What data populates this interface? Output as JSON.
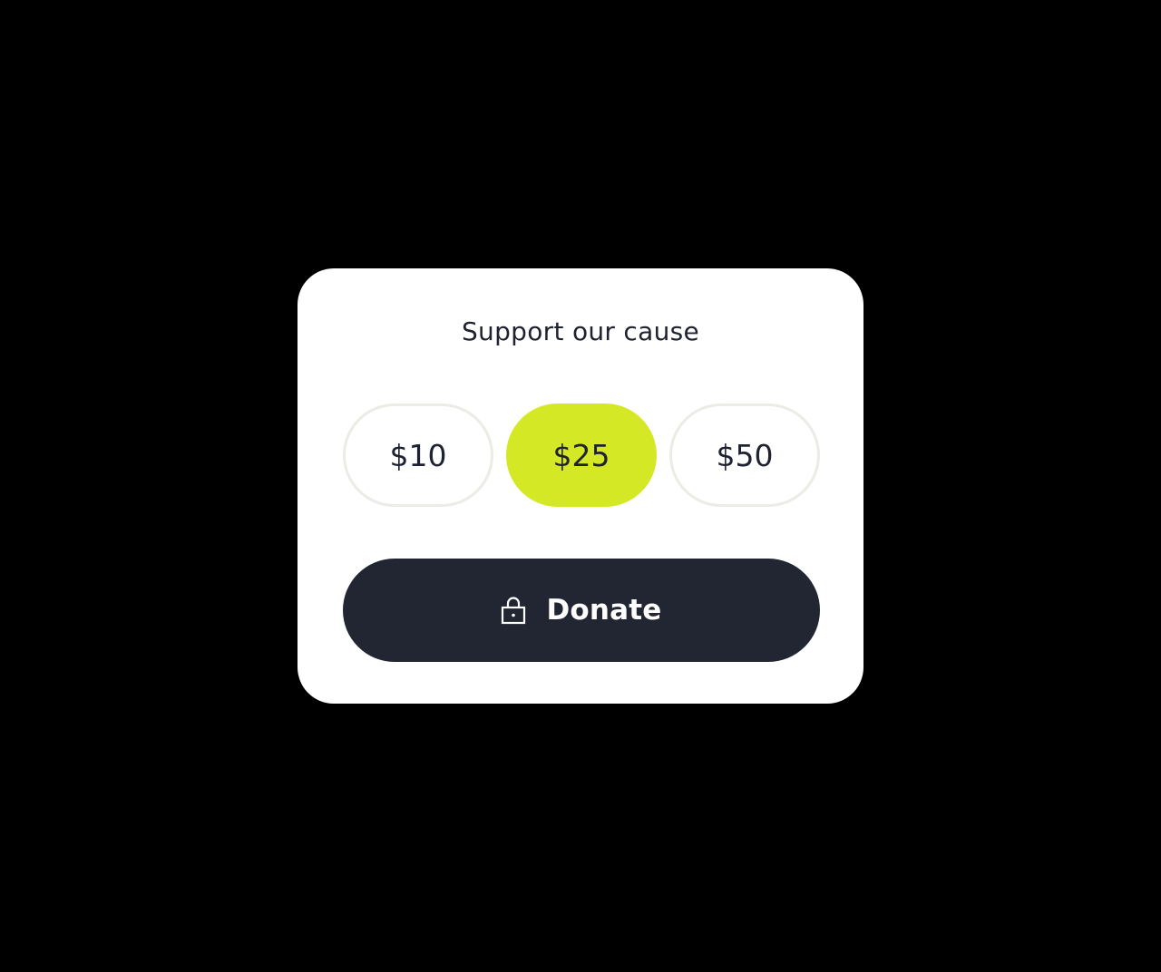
{
  "card": {
    "title": "Support our cause"
  },
  "amounts": [
    {
      "label": "$10",
      "selected": false
    },
    {
      "label": "$25",
      "selected": true
    },
    {
      "label": "$50",
      "selected": false
    }
  ],
  "donate": {
    "label": "Donate",
    "icon": "lock-icon"
  },
  "colors": {
    "accent": "#d4e826",
    "button_dark": "#222632",
    "text": "#1f2230",
    "pill_border": "#ecebe6"
  }
}
